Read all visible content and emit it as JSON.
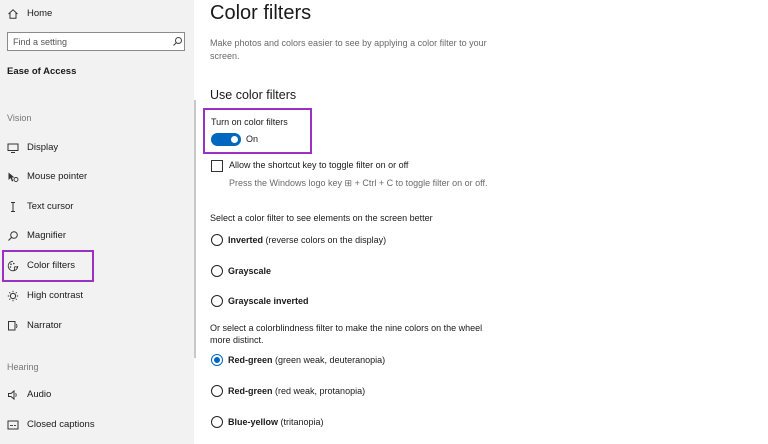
{
  "sidebar": {
    "home_label": "Home",
    "search_placeholder": "Find a setting",
    "category": "Ease of Access",
    "vision_section": "Vision",
    "vision_items": [
      "Display",
      "Mouse pointer",
      "Text cursor",
      "Magnifier",
      "Color filters",
      "High contrast",
      "Narrator"
    ],
    "hearing_section": "Hearing",
    "hearing_items": [
      "Audio",
      "Closed captions"
    ],
    "selected_item": "Color filters"
  },
  "main": {
    "title": "Color filters",
    "description": "Make photos and colors easier to see by applying a color filter to your screen.",
    "section_heading": "Use color filters",
    "toggle_label": "Turn on color filters",
    "toggle_state": "On",
    "shortcut_checkbox_label": "Allow the shortcut key to toggle filter on or off",
    "shortcut_hint": "Press the Windows logo key ⊞ + Ctrl + C to toggle filter on or off.",
    "filter_prompt": "Select a color filter to see elements on the screen better",
    "filters": [
      {
        "name": "Inverted",
        "detail": "(reverse colors on the display)"
      },
      {
        "name": "Grayscale",
        "detail": ""
      },
      {
        "name": "Grayscale inverted",
        "detail": ""
      }
    ],
    "colorblind_prompt": "Or select a colorblindness filter to make the nine colors on the wheel more distinct.",
    "colorblind_filters": [
      {
        "name": "Red-green",
        "detail": "(green weak, deuteranopia)",
        "selected": true
      },
      {
        "name": "Red-green",
        "detail": "(red weak, protanopia)",
        "selected": false
      },
      {
        "name": "Blue-yellow",
        "detail": "(tritanopia)",
        "selected": false
      }
    ]
  },
  "colors": {
    "accent": "#0067c0",
    "highlight": "#9b30c4",
    "sidebar_bg": "#f2f2f2"
  }
}
